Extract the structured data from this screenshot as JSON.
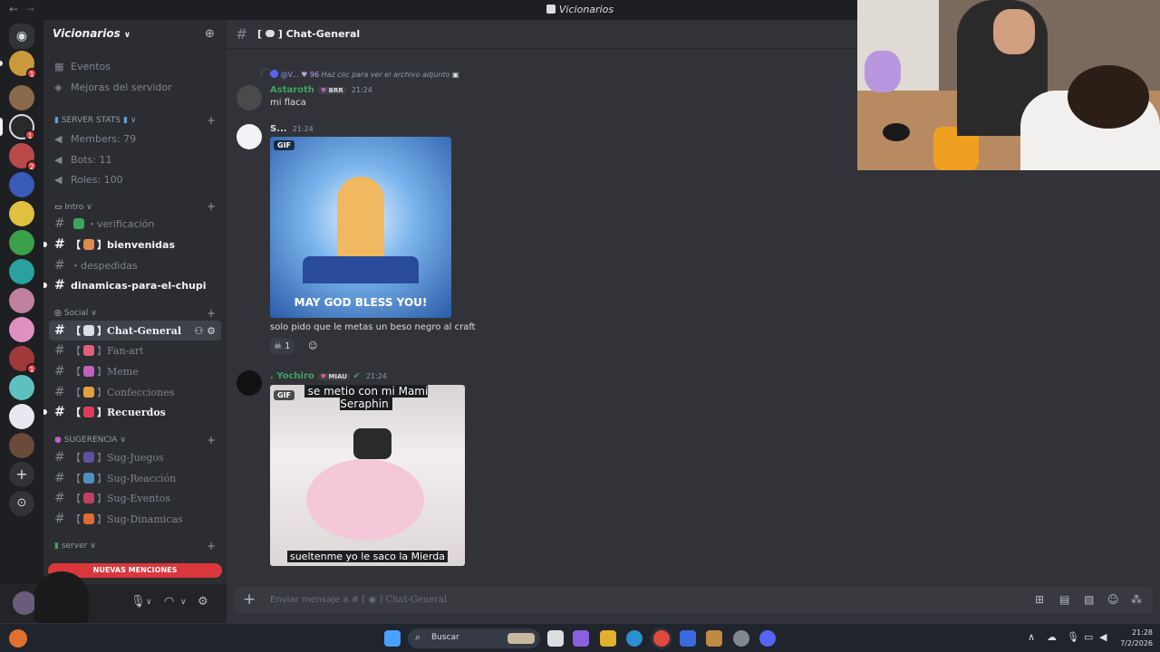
{
  "window": {
    "title": "Vicionarios"
  },
  "server": {
    "name": "Vicionarios"
  },
  "sidebar": {
    "top_items": [
      {
        "label": "Eventos",
        "icon": "calendar-icon"
      },
      {
        "label": "Mejoras del servidor",
        "icon": "boost-icon"
      }
    ],
    "categories": {
      "stats": "SERVER STATS",
      "intro": "Intro",
      "social": "Social",
      "sugerencia": "SUGERENCIA",
      "server": "server"
    },
    "stats": [
      {
        "label": "Members: 79"
      },
      {
        "label": "Bots: 11"
      },
      {
        "label": "Roles: 100"
      }
    ],
    "intro_channels": [
      {
        "label": "verificación"
      },
      {
        "label": "bienvenidas"
      },
      {
        "label": "despedidas"
      },
      {
        "label": "dinamicas-para-el-chupi"
      }
    ],
    "social_channels": [
      {
        "label": "Chat-General"
      },
      {
        "label": "Fan-art"
      },
      {
        "label": "Meme"
      },
      {
        "label": "Confecciones"
      },
      {
        "label": "Recuerdos"
      }
    ],
    "sugerencia_channels": [
      {
        "label": "Sug-Juegos"
      },
      {
        "label": "Sug-Reacción"
      },
      {
        "label": "Sug-Eventos"
      },
      {
        "label": "Sug-Dinamicas"
      }
    ],
    "new_mentions": "NUEVAS MENCIONES"
  },
  "chat": {
    "channel": "Chat-General",
    "bracket_open": "[",
    "bracket_close": "]",
    "messages": [
      {
        "reply_user": "@V...",
        "reply_badge": "96",
        "reply_text": "Haz clic para ver el archivo adjunto",
        "author": "Astaroth",
        "author_color": "#3ba55d",
        "tag": "BRR",
        "time": "21:24",
        "text": "mi flaca"
      },
      {
        "author": "S...",
        "author_color": "#dbdee1",
        "time": "21:24",
        "gif_label": "GIF",
        "gif_caption": "MAY GOD BLESS YOU!",
        "text": "solo pido que le metas un beso negro al craft",
        "reaction_count": "1"
      },
      {
        "author": ". Yochiro",
        "author_color": "#3ba55d",
        "tag": "MIAU",
        "time": "21:24",
        "gif_label": "GIF",
        "gif_caption_top": "se metio con mi Mami Seraphin",
        "gif_caption_bottom": "sueltenme yo le saco la Mierda"
      }
    ]
  },
  "composer": {
    "placeholder": "Enviar mensaje a #",
    "channel": "Chat-General"
  },
  "taskbar": {
    "search_label": "Buscar",
    "time": "21:28",
    "date": "7/2/2026"
  },
  "colors": {
    "accent": "#5865f2",
    "mention": "#da373c",
    "online": "#23a55a"
  }
}
